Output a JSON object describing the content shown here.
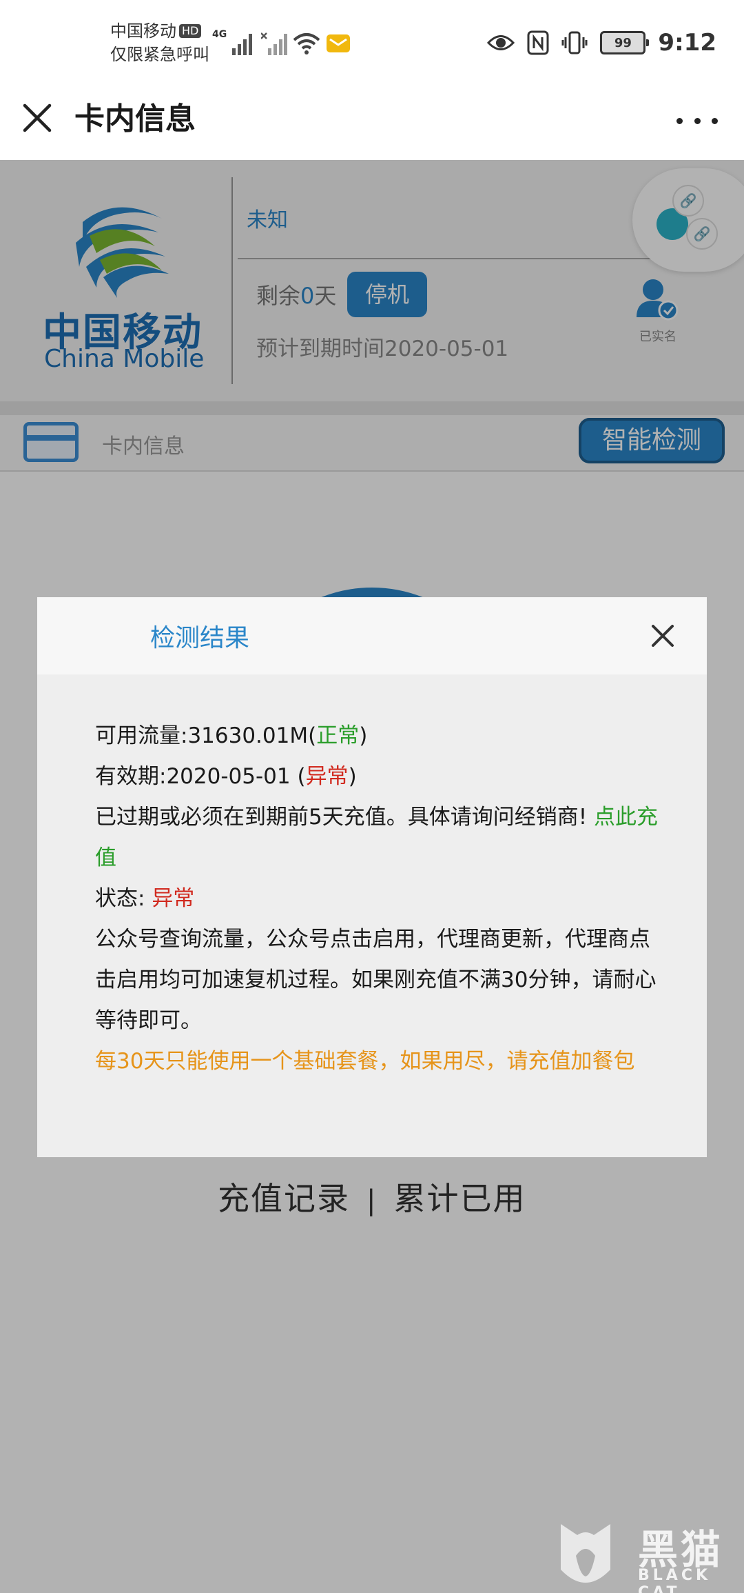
{
  "status_bar": {
    "carrier": "中国移动",
    "hd_badge": "HD",
    "emergency": "仅限紧急呼叫",
    "network": "4G",
    "battery": "99",
    "time": "9:12"
  },
  "title_bar": {
    "title": "卡内信息"
  },
  "card": {
    "logo_cn": "中国移动",
    "logo_en": "China Mobile",
    "name": "未知",
    "remain_prefix": "剩余",
    "remain_days": "0",
    "remain_suffix": "天",
    "status_button": "停机",
    "expire_text": "预计到期时间2020-05-01",
    "verified_label": "已实名"
  },
  "info_row": {
    "label": "卡内信息",
    "detect_button": "智能检测"
  },
  "bottom_links": {
    "recharge_records": "充值记录",
    "separator": "|",
    "total_used": "累计已用"
  },
  "modal": {
    "title": "检测结果",
    "flow_prefix": "可用流量:31630.01M(",
    "flow_status": "正常",
    "flow_suffix": ")",
    "validity_prefix": "有效期:2020-05-01 (",
    "validity_status": "异常",
    "validity_suffix": ")",
    "expired_text": "已过期或必须在到期前5天充值。具体请询问经销商! ",
    "recharge_link": "点此充值",
    "state_prefix": "状态: ",
    "state_value": "异常",
    "tip": "公众号查询流量，公众号点击启用，代理商更新，代理商点击启用均可加速复机过程。如果刚充值不满30分钟，请耐心等待即可。",
    "warning": "每30天只能使用一个基础套餐，如果用尽，请充值加餐包"
  },
  "watermark": {
    "cn": "黑猫",
    "en": "BLACK CAT"
  },
  "colors": {
    "accent_blue": "#2a86c9",
    "ok_green": "#2a9d2a",
    "error_red": "#d12a1f",
    "warning_orange": "#e6941a"
  }
}
